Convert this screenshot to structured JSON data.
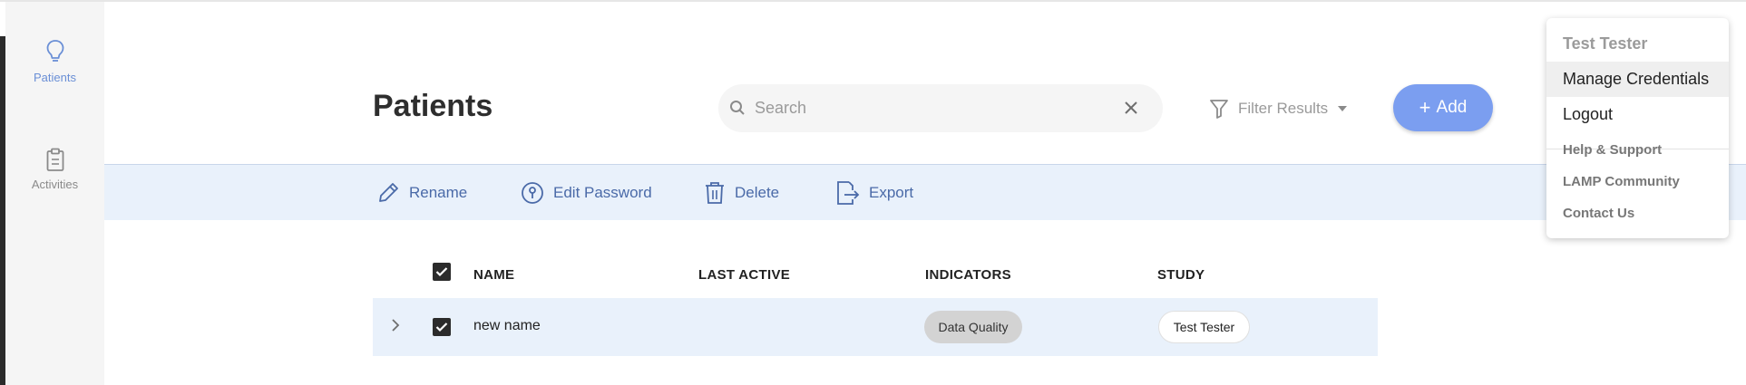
{
  "sidebar": {
    "items": [
      {
        "label": "Patients",
        "icon": "lightbulb-icon",
        "active": true
      },
      {
        "label": "Activities",
        "icon": "clipboard-icon",
        "active": false
      }
    ]
  },
  "header": {
    "title": "Patients",
    "search": {
      "placeholder": "Search",
      "value": ""
    },
    "filter_label": "Filter Results",
    "add_label": "Add"
  },
  "toolbar": {
    "rename_label": "Rename",
    "edit_password_label": "Edit Password",
    "delete_label": "Delete",
    "export_label": "Export"
  },
  "table": {
    "columns": [
      "NAME",
      "LAST ACTIVE",
      "INDICATORS",
      "STUDY"
    ],
    "rows": [
      {
        "name": "new name",
        "last_active": "",
        "indicator": "Data Quality",
        "study": "Test Tester",
        "checked": true
      }
    ]
  },
  "user_menu": {
    "user_name": "Test Tester",
    "items": [
      "Manage Credentials",
      "Logout"
    ],
    "links": [
      "Help & Support",
      "LAMP Community",
      "Contact Us"
    ]
  },
  "colors": {
    "accent": "#7b9ef0",
    "toolbar_bg": "#e9f1fb",
    "toolbar_text": "#4a6aa8",
    "sidebar_active": "#6a8fd6"
  }
}
